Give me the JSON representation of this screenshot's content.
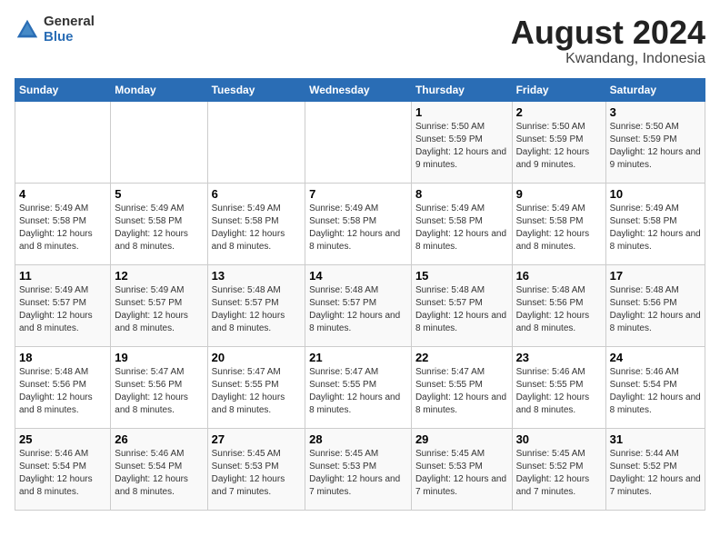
{
  "header": {
    "logo_general": "General",
    "logo_blue": "Blue",
    "main_title": "August 2024",
    "subtitle": "Kwandang, Indonesia"
  },
  "days_of_week": [
    "Sunday",
    "Monday",
    "Tuesday",
    "Wednesday",
    "Thursday",
    "Friday",
    "Saturday"
  ],
  "weeks": [
    [
      {
        "day": "",
        "sunrise": "",
        "sunset": "",
        "daylight": ""
      },
      {
        "day": "",
        "sunrise": "",
        "sunset": "",
        "daylight": ""
      },
      {
        "day": "",
        "sunrise": "",
        "sunset": "",
        "daylight": ""
      },
      {
        "day": "",
        "sunrise": "",
        "sunset": "",
        "daylight": ""
      },
      {
        "day": "1",
        "sunrise": "Sunrise: 5:50 AM",
        "sunset": "Sunset: 5:59 PM",
        "daylight": "Daylight: 12 hours and 9 minutes."
      },
      {
        "day": "2",
        "sunrise": "Sunrise: 5:50 AM",
        "sunset": "Sunset: 5:59 PM",
        "daylight": "Daylight: 12 hours and 9 minutes."
      },
      {
        "day": "3",
        "sunrise": "Sunrise: 5:50 AM",
        "sunset": "Sunset: 5:59 PM",
        "daylight": "Daylight: 12 hours and 9 minutes."
      }
    ],
    [
      {
        "day": "4",
        "sunrise": "Sunrise: 5:49 AM",
        "sunset": "Sunset: 5:58 PM",
        "daylight": "Daylight: 12 hours and 8 minutes."
      },
      {
        "day": "5",
        "sunrise": "Sunrise: 5:49 AM",
        "sunset": "Sunset: 5:58 PM",
        "daylight": "Daylight: 12 hours and 8 minutes."
      },
      {
        "day": "6",
        "sunrise": "Sunrise: 5:49 AM",
        "sunset": "Sunset: 5:58 PM",
        "daylight": "Daylight: 12 hours and 8 minutes."
      },
      {
        "day": "7",
        "sunrise": "Sunrise: 5:49 AM",
        "sunset": "Sunset: 5:58 PM",
        "daylight": "Daylight: 12 hours and 8 minutes."
      },
      {
        "day": "8",
        "sunrise": "Sunrise: 5:49 AM",
        "sunset": "Sunset: 5:58 PM",
        "daylight": "Daylight: 12 hours and 8 minutes."
      },
      {
        "day": "9",
        "sunrise": "Sunrise: 5:49 AM",
        "sunset": "Sunset: 5:58 PM",
        "daylight": "Daylight: 12 hours and 8 minutes."
      },
      {
        "day": "10",
        "sunrise": "Sunrise: 5:49 AM",
        "sunset": "Sunset: 5:58 PM",
        "daylight": "Daylight: 12 hours and 8 minutes."
      }
    ],
    [
      {
        "day": "11",
        "sunrise": "Sunrise: 5:49 AM",
        "sunset": "Sunset: 5:57 PM",
        "daylight": "Daylight: 12 hours and 8 minutes."
      },
      {
        "day": "12",
        "sunrise": "Sunrise: 5:49 AM",
        "sunset": "Sunset: 5:57 PM",
        "daylight": "Daylight: 12 hours and 8 minutes."
      },
      {
        "day": "13",
        "sunrise": "Sunrise: 5:48 AM",
        "sunset": "Sunset: 5:57 PM",
        "daylight": "Daylight: 12 hours and 8 minutes."
      },
      {
        "day": "14",
        "sunrise": "Sunrise: 5:48 AM",
        "sunset": "Sunset: 5:57 PM",
        "daylight": "Daylight: 12 hours and 8 minutes."
      },
      {
        "day": "15",
        "sunrise": "Sunrise: 5:48 AM",
        "sunset": "Sunset: 5:57 PM",
        "daylight": "Daylight: 12 hours and 8 minutes."
      },
      {
        "day": "16",
        "sunrise": "Sunrise: 5:48 AM",
        "sunset": "Sunset: 5:56 PM",
        "daylight": "Daylight: 12 hours and 8 minutes."
      },
      {
        "day": "17",
        "sunrise": "Sunrise: 5:48 AM",
        "sunset": "Sunset: 5:56 PM",
        "daylight": "Daylight: 12 hours and 8 minutes."
      }
    ],
    [
      {
        "day": "18",
        "sunrise": "Sunrise: 5:48 AM",
        "sunset": "Sunset: 5:56 PM",
        "daylight": "Daylight: 12 hours and 8 minutes."
      },
      {
        "day": "19",
        "sunrise": "Sunrise: 5:47 AM",
        "sunset": "Sunset: 5:56 PM",
        "daylight": "Daylight: 12 hours and 8 minutes."
      },
      {
        "day": "20",
        "sunrise": "Sunrise: 5:47 AM",
        "sunset": "Sunset: 5:55 PM",
        "daylight": "Daylight: 12 hours and 8 minutes."
      },
      {
        "day": "21",
        "sunrise": "Sunrise: 5:47 AM",
        "sunset": "Sunset: 5:55 PM",
        "daylight": "Daylight: 12 hours and 8 minutes."
      },
      {
        "day": "22",
        "sunrise": "Sunrise: 5:47 AM",
        "sunset": "Sunset: 5:55 PM",
        "daylight": "Daylight: 12 hours and 8 minutes."
      },
      {
        "day": "23",
        "sunrise": "Sunrise: 5:46 AM",
        "sunset": "Sunset: 5:55 PM",
        "daylight": "Daylight: 12 hours and 8 minutes."
      },
      {
        "day": "24",
        "sunrise": "Sunrise: 5:46 AM",
        "sunset": "Sunset: 5:54 PM",
        "daylight": "Daylight: 12 hours and 8 minutes."
      }
    ],
    [
      {
        "day": "25",
        "sunrise": "Sunrise: 5:46 AM",
        "sunset": "Sunset: 5:54 PM",
        "daylight": "Daylight: 12 hours and 8 minutes."
      },
      {
        "day": "26",
        "sunrise": "Sunrise: 5:46 AM",
        "sunset": "Sunset: 5:54 PM",
        "daylight": "Daylight: 12 hours and 8 minutes."
      },
      {
        "day": "27",
        "sunrise": "Sunrise: 5:45 AM",
        "sunset": "Sunset: 5:53 PM",
        "daylight": "Daylight: 12 hours and 7 minutes."
      },
      {
        "day": "28",
        "sunrise": "Sunrise: 5:45 AM",
        "sunset": "Sunset: 5:53 PM",
        "daylight": "Daylight: 12 hours and 7 minutes."
      },
      {
        "day": "29",
        "sunrise": "Sunrise: 5:45 AM",
        "sunset": "Sunset: 5:53 PM",
        "daylight": "Daylight: 12 hours and 7 minutes."
      },
      {
        "day": "30",
        "sunrise": "Sunrise: 5:45 AM",
        "sunset": "Sunset: 5:52 PM",
        "daylight": "Daylight: 12 hours and 7 minutes."
      },
      {
        "day": "31",
        "sunrise": "Sunrise: 5:44 AM",
        "sunset": "Sunset: 5:52 PM",
        "daylight": "Daylight: 12 hours and 7 minutes."
      }
    ]
  ]
}
